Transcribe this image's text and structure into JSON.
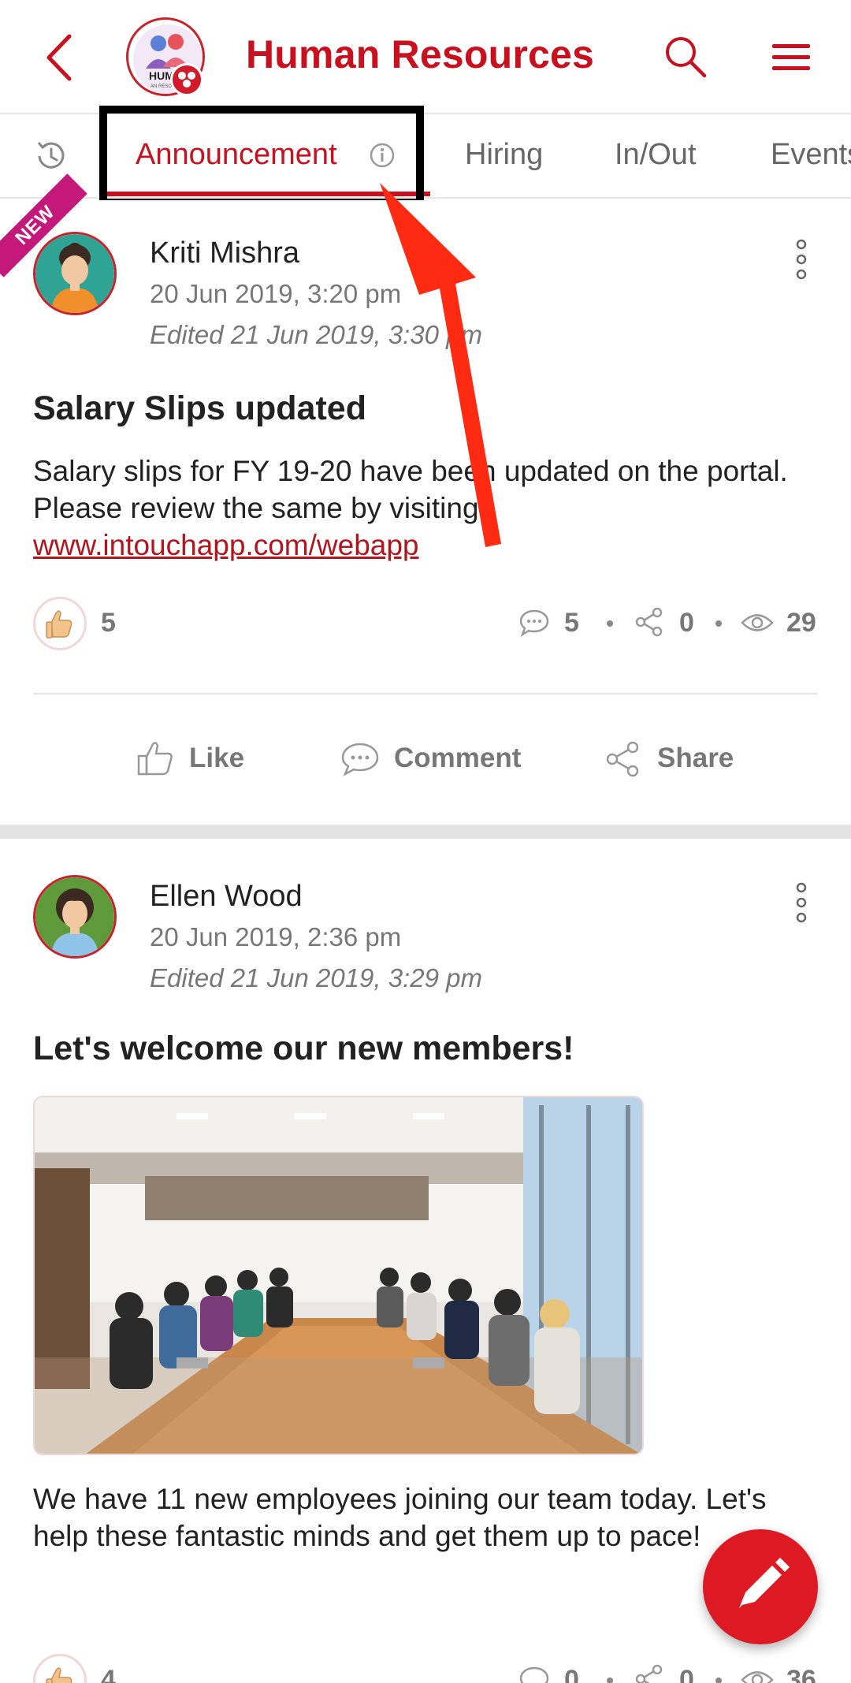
{
  "header": {
    "title": "Human Resources",
    "logo_text": "HUM",
    "logo_subtext": "AN RESOUR"
  },
  "tabs": [
    {
      "label": "Announcement",
      "active": true
    },
    {
      "label": "Hiring",
      "active": false
    },
    {
      "label": "In/Out",
      "active": false
    },
    {
      "label": "Events",
      "active": false
    }
  ],
  "posts": [
    {
      "badge": "NEW",
      "author": "Kriti Mishra",
      "date": "20 Jun 2019, 3:20 pm",
      "edited": "Edited 21 Jun 2019, 3:30 pm",
      "title": "Salary Slips updated",
      "body": "Salary slips for FY 19-20 have been updated on the portal. Please review the same by visiting ",
      "link": "www.intouchapp.com/webapp",
      "likes": "5",
      "comments": "5",
      "shares": "0",
      "views": "29"
    },
    {
      "author": "Ellen Wood",
      "date": "20 Jun 2019, 2:36 pm",
      "edited": "Edited 21 Jun 2019, 3:29 pm",
      "title": "Let's welcome our new members!",
      "body": "We have 11 new employees joining our team today. Let's help these fantastic minds and get them up to pace!",
      "likes": "4",
      "comments": "0",
      "shares": "0",
      "views": "36"
    }
  ],
  "actions": {
    "like": "Like",
    "comment": "Comment",
    "share": "Share"
  },
  "colors": {
    "brand": "#c8101e",
    "annotation_arrow": "#ff2a12",
    "badge": "#c4197b"
  }
}
